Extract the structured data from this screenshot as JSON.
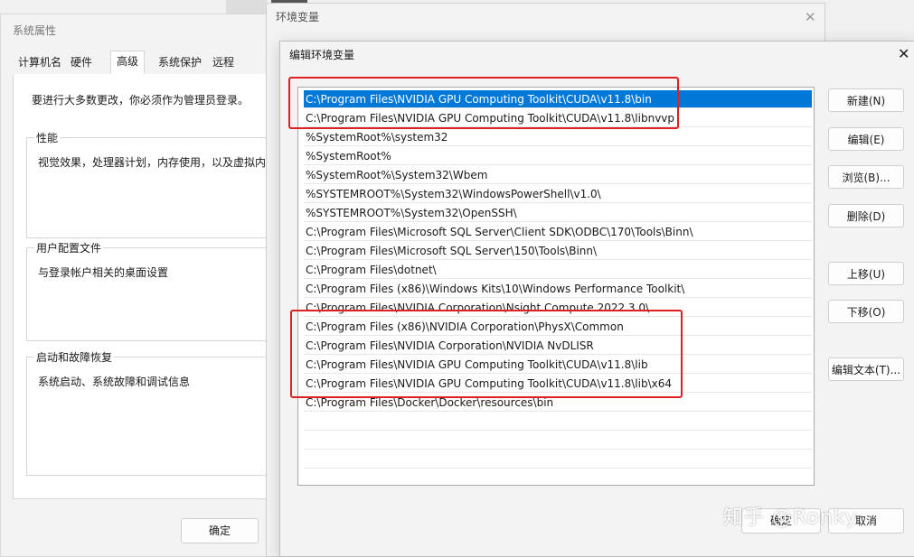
{
  "system_properties": {
    "title": "系统属性",
    "tabs": [
      "计算机名",
      "硬件",
      "高级",
      "系统保护",
      "远程"
    ],
    "active_tab": "高级",
    "note": "要进行大多数更改，你必须作为管理员登录。",
    "groups": [
      {
        "label": "性能",
        "text": "视觉效果，处理器计划，内存使用，以及虚拟内存"
      },
      {
        "label": "用户配置文件",
        "text": "与登录帐户相关的桌面设置"
      },
      {
        "label": "启动和故障恢复",
        "text": "系统启动、系统故障和调试信息"
      }
    ],
    "ok_label": "确定"
  },
  "env_window": {
    "title": "环境变量"
  },
  "edit_dialog": {
    "title": "编辑环境变量",
    "paths": [
      "C:\\Program Files\\NVIDIA GPU Computing Toolkit\\CUDA\\v11.8\\bin",
      "C:\\Program Files\\NVIDIA GPU Computing Toolkit\\CUDA\\v11.8\\libnvvp",
      "%SystemRoot%\\system32",
      "%SystemRoot%",
      "%SystemRoot%\\System32\\Wbem",
      "%SYSTEMROOT%\\System32\\WindowsPowerShell\\v1.0\\",
      "%SYSTEMROOT%\\System32\\OpenSSH\\",
      "C:\\Program Files\\Microsoft SQL Server\\Client SDK\\ODBC\\170\\Tools\\Binn\\",
      "C:\\Program Files\\Microsoft SQL Server\\150\\Tools\\Binn\\",
      "C:\\Program Files\\dotnet\\",
      "C:\\Program Files (x86)\\Windows Kits\\10\\Windows Performance Toolkit\\",
      "C:\\Program Files\\NVIDIA Corporation\\Nsight Compute 2022.3.0\\",
      "C:\\Program Files (x86)\\NVIDIA Corporation\\PhysX\\Common",
      "C:\\Program Files\\NVIDIA Corporation\\NVIDIA NvDLISR",
      "C:\\Program Files\\NVIDIA GPU Computing Toolkit\\CUDA\\v11.8\\lib",
      "C:\\Program Files\\NVIDIA GPU Computing Toolkit\\CUDA\\v11.8\\lib\\x64",
      "C:\\Program Files\\Docker\\Docker\\resources\\bin"
    ],
    "selected_index": 0,
    "buttons": {
      "new": "新建(N)",
      "edit": "编辑(E)",
      "browse": "浏览(B)...",
      "delete": "删除(D)",
      "move_up": "上移(U)",
      "move_down": "下移(O)",
      "edit_text": "编辑文本(T)..."
    },
    "ok_label": "确定",
    "cancel_label": "取消"
  },
  "watermark": "知乎 @Ronky",
  "highlight_color": "#e02020",
  "selection_color": "#0078d7"
}
